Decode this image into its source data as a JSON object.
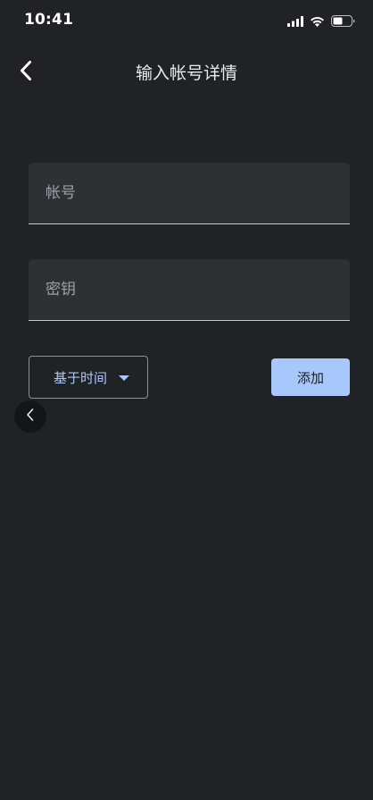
{
  "status_bar": {
    "time": "10:41",
    "icons": [
      "cellular-signal-icon",
      "wifi-icon",
      "battery-icon"
    ]
  },
  "app_bar": {
    "back_icon": "chevron-left-icon",
    "title": "输入帐号详情"
  },
  "form": {
    "account_placeholder": "帐号",
    "account_value": "",
    "key_placeholder": "密钥",
    "key_value": "",
    "type_select": {
      "selected": "基于时间",
      "icon": "dropdown-arrow-icon"
    },
    "add_button_label": "添加"
  },
  "floating_back": {
    "icon": "chevron-left-icon"
  },
  "colors": {
    "background": "#212226",
    "field_background": "#2f3034",
    "accent": "#a8c7fa",
    "text_primary": "#e8eaed",
    "text_placeholder": "#9aa0a6"
  }
}
